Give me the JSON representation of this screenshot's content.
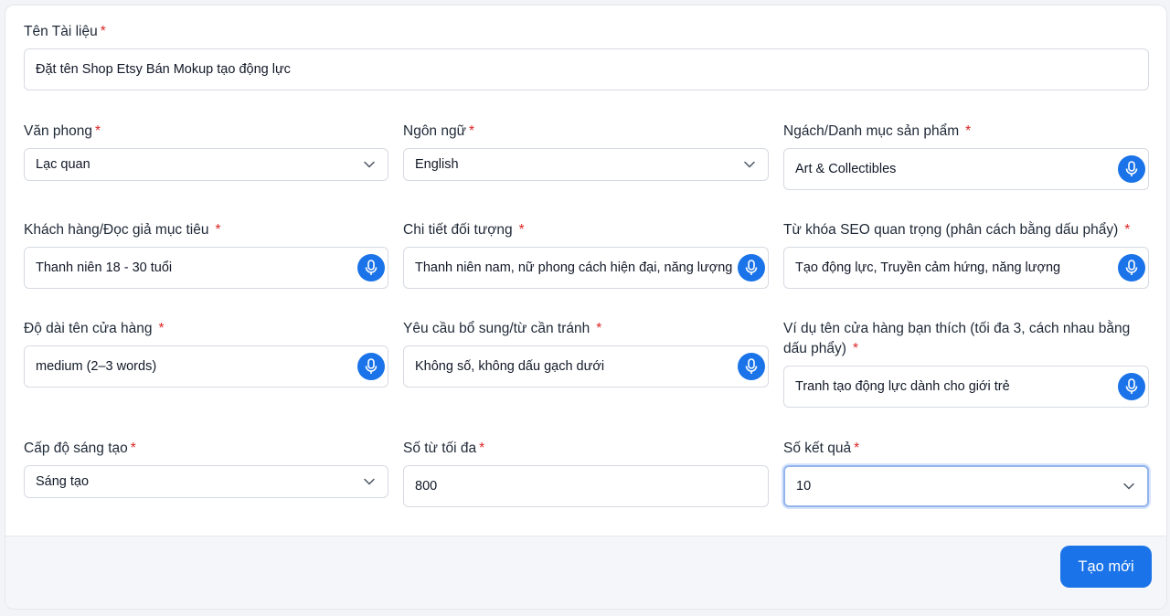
{
  "form": {
    "title": {
      "label": "Tên Tài liệu",
      "required": "*",
      "value": "Đặt tên Shop Etsy Bán Mokup tạo động lực"
    },
    "tone": {
      "label": "Văn phong",
      "required": "*",
      "value": "Lạc quan"
    },
    "language": {
      "label": "Ngôn ngữ",
      "required": "*",
      "value": "English"
    },
    "niche": {
      "label": "Ngách/Danh mục sản phẩm",
      "required": "*",
      "value": "Art & Collectibles"
    },
    "audience": {
      "label": "Khách hàng/Đọc giả mục tiêu",
      "required": "*",
      "value": "Thanh niên 18 - 30 tuổi"
    },
    "audience_detail": {
      "label": "Chi tiết đối tượng",
      "required": "*",
      "value": "Thanh niên nam, nữ phong cách hiện đại, năng lượng"
    },
    "seo_keywords": {
      "label": "Từ khóa SEO quan trọng (phân cách bằng dấu phẩy)",
      "required": "*",
      "value": "Tạo động lực, Truyền cảm hứng, năng lượng"
    },
    "name_length": {
      "label": "Độ dài tên cửa hàng",
      "required": "*",
      "value": "medium (2–3 words)"
    },
    "extra_requirements": {
      "label": "Yêu cầu bổ sung/từ cần tránh",
      "required": "*",
      "value": "Không số, không dấu gạch dưới"
    },
    "examples": {
      "label": "Ví dụ tên cửa hàng bạn thích (tối đa 3, cách nhau bằng dấu phẩy)",
      "required": "*",
      "value": "Tranh tạo động lực dành cho giới trẻ"
    },
    "creativity": {
      "label": "Cấp độ sáng tạo",
      "required": "*",
      "value": "Sáng tạo"
    },
    "max_words": {
      "label": "Số từ tối đa",
      "required": "*",
      "value": "800"
    },
    "num_results": {
      "label": "Số kết quả",
      "required": "*",
      "value": "10"
    }
  },
  "footer": {
    "submit_label": "Tạo mới"
  },
  "icons": {
    "mic": "microphone-icon",
    "chevron": "chevron-down-icon"
  },
  "colors": {
    "accent": "#1a73e8",
    "required": "#dc2626",
    "footer_bg": "#f4f6fa"
  }
}
